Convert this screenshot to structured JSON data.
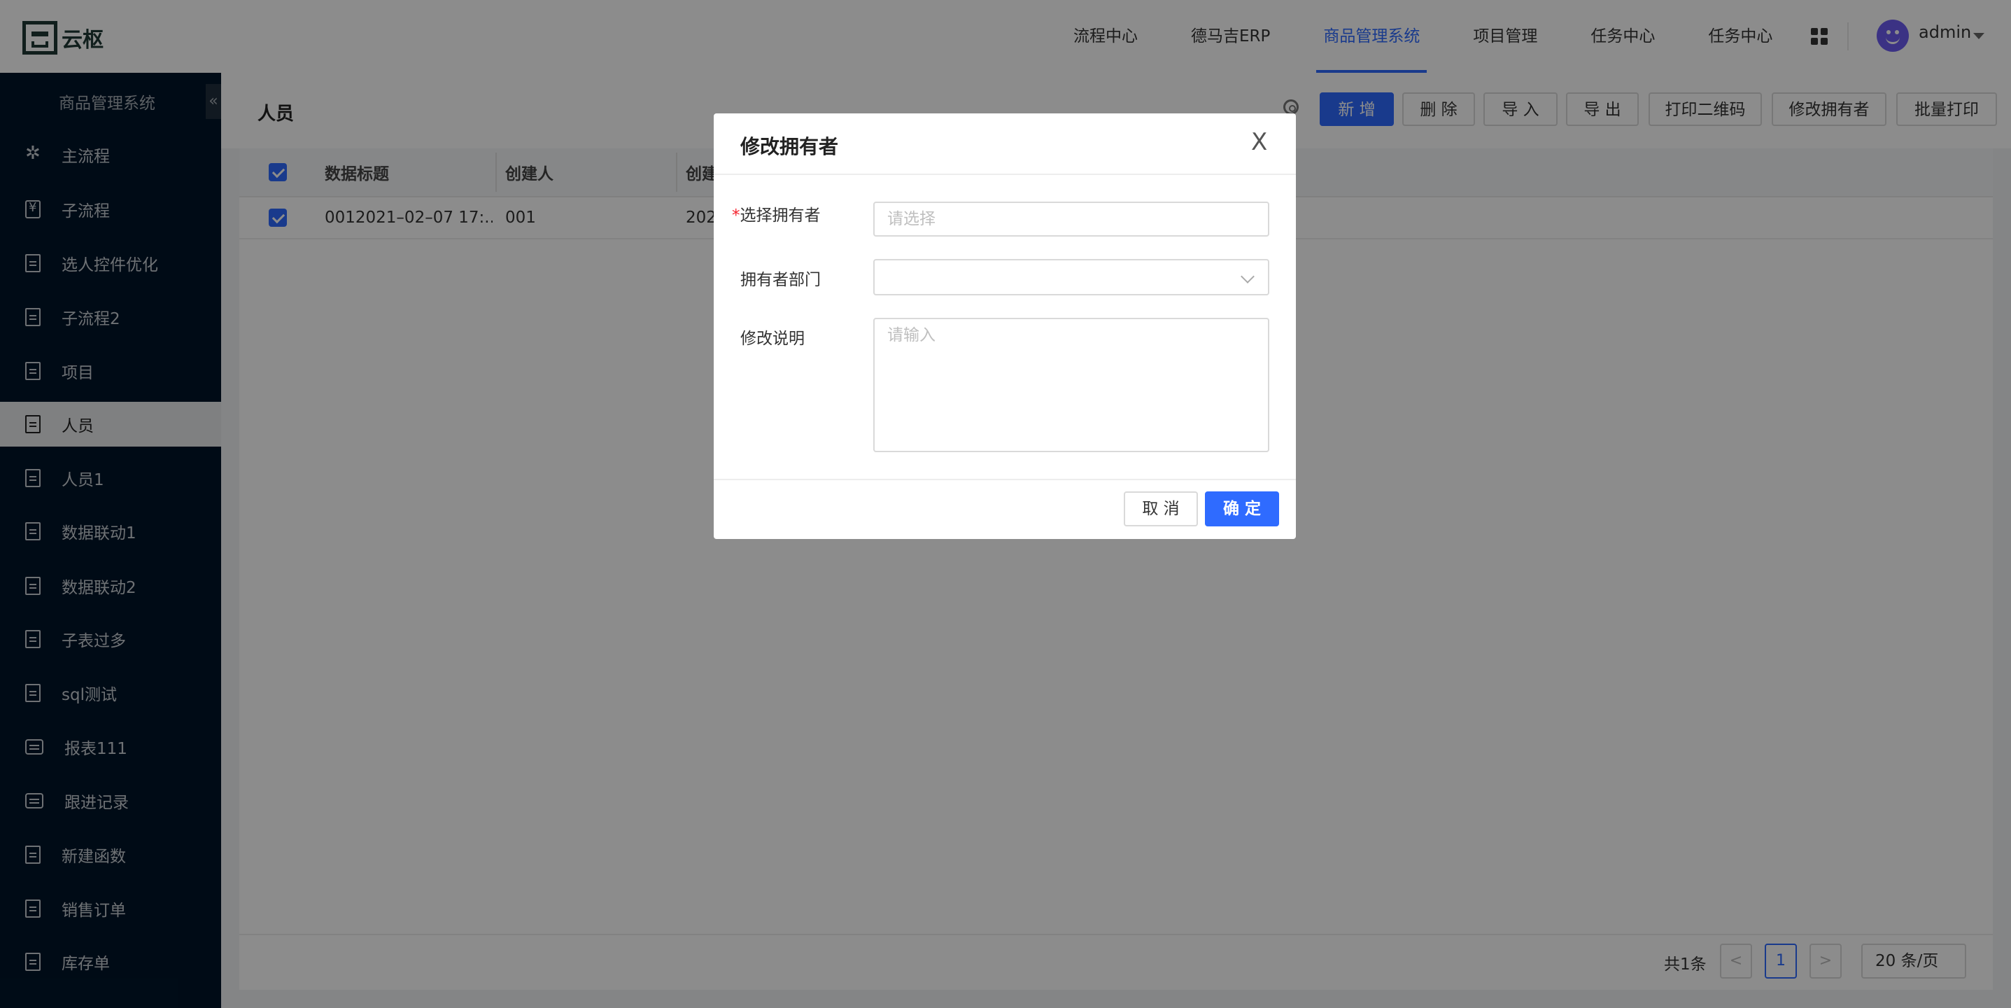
{
  "header": {
    "logo_text": "云枢",
    "nav": [
      "流程中心",
      "德马吉ERP",
      "商品管理系统",
      "项目管理",
      "任务中心",
      "任务中心"
    ],
    "active_nav_index": 2,
    "user_name": "admin"
  },
  "sidebar": {
    "title": "商品管理系统",
    "collapse_glyph": "«",
    "items": [
      {
        "label": "主流程",
        "icon": "flow-icon"
      },
      {
        "label": "子流程",
        "icon": "yen-doc-icon"
      },
      {
        "label": "选人控件优化",
        "icon": "document-icon"
      },
      {
        "label": "子流程2",
        "icon": "document-icon"
      },
      {
        "label": "项目",
        "icon": "document-icon"
      },
      {
        "label": "人员",
        "icon": "document-icon",
        "active": true
      },
      {
        "label": "人员1",
        "icon": "document-icon"
      },
      {
        "label": "数据联动1",
        "icon": "document-icon"
      },
      {
        "label": "数据联动2",
        "icon": "document-icon"
      },
      {
        "label": "子表过多",
        "icon": "document-icon"
      },
      {
        "label": "sql测试",
        "icon": "document-icon"
      },
      {
        "label": "报表111",
        "icon": "report-icon"
      },
      {
        "label": "跟进记录",
        "icon": "report-icon"
      },
      {
        "label": "新建函数",
        "icon": "document-icon"
      },
      {
        "label": "销售订单",
        "icon": "document-icon"
      },
      {
        "label": "库存单",
        "icon": "document-icon"
      }
    ]
  },
  "page": {
    "title": "人员",
    "toolbar": {
      "add": "新 增",
      "delete": "删 除",
      "import": "导 入",
      "export": "导 出",
      "print_qr": "打印二维码",
      "change_owner": "修改拥有者",
      "batch_print": "批量打印"
    }
  },
  "table": {
    "columns": [
      "数据标题",
      "创建人",
      "创建"
    ],
    "rows": [
      {
        "title": "0012021–02–07 17:...",
        "creator": "001",
        "created": "202",
        "checked": true
      }
    ]
  },
  "pagination": {
    "total": "共1条",
    "prev": "<",
    "current": "1",
    "next": ">",
    "page_size": "20 条/页"
  },
  "modal": {
    "title": "修改拥有者",
    "close": "X",
    "fields": {
      "owner_label": "选择拥有者",
      "owner_required_mark": "*",
      "owner_placeholder": "请选择",
      "dept_label": "拥有者部门",
      "dept_value": "",
      "note_label": "修改说明",
      "note_placeholder": "请输入"
    },
    "cancel": "取 消",
    "ok": "确 定"
  },
  "colors": {
    "primary": "#2f6bff",
    "sidebar_bg": "#001529",
    "required": "#f5222d"
  }
}
